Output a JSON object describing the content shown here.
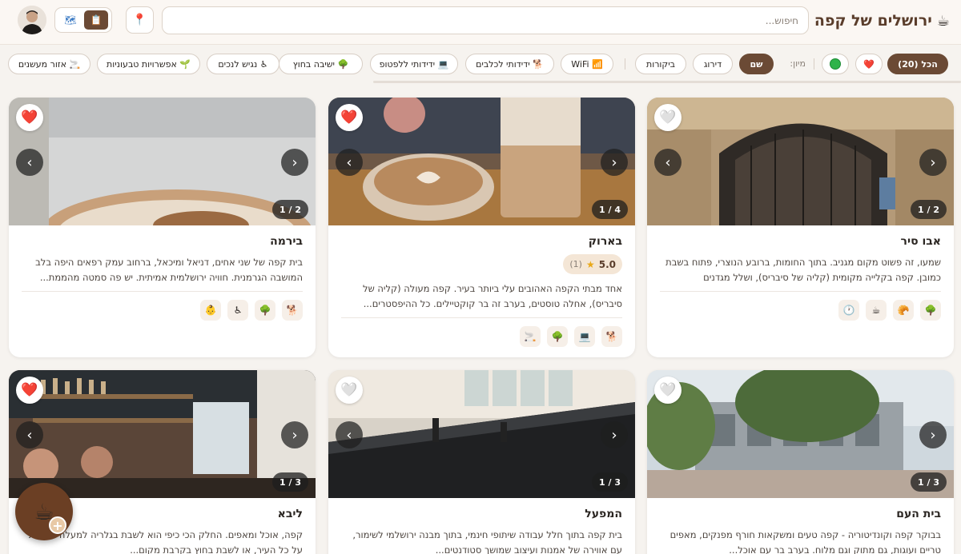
{
  "header": {
    "title": "ירושלים של קפה",
    "logo_icon": "coffee-cup",
    "search_placeholder": "חיפוש...",
    "locate_icon": "map-pin",
    "view_list_icon": "clipboard",
    "view_map_icon": "map"
  },
  "filters": {
    "all_label": "הכל (20)",
    "sort_label": "מיון:",
    "sort": {
      "name": "שם",
      "rating": "דירוג",
      "reviews": "ביקורות"
    },
    "chips": {
      "wifi": "📶 WiFi",
      "dogs": "🐕 ידידותי לכלבים",
      "laptop": "💻 ידידותי ללפטופ",
      "outdoor": "🌳 ישיבה בחוץ",
      "accessible": "♿ נגיש לנכים",
      "vegan": "🌱 אפשרויות טבעוניות",
      "smoking": "🚬 אזור מעשנים"
    }
  },
  "cards": [
    {
      "name": "אבו סיר",
      "description": "שמעו, זה פשוט מקום מגניב. בתוך החומות, ברובע הנוצרי, פתוח בשבת כמובן. קפה בקלייה מקומית (קליה של סיבריס), ושלל מגדנים ומאפים,...",
      "counter": "1 / 2",
      "favorite": false,
      "features": [
        "🌳",
        "🥐",
        "☕",
        "🕐"
      ]
    },
    {
      "name": "בארוק",
      "rating": "5.0",
      "rating_count": "(1)",
      "description": "אחד מבתי הקפה האהובים עלי ביותר בעיר. קפה מעולה (קליה של סיבריס), אחלה טוסטים, בערב זה בר קוקטיילים. כל ההיפסטרים...",
      "counter": "1 / 4",
      "favorite": true,
      "features": [
        "🐕",
        "💻",
        "🌳",
        "🚬"
      ]
    },
    {
      "name": "בירמה",
      "description": "בית קפה של שני אחים, דניאל ומיכאל, ברחוב עמק רפאים היפה בלב המושבה הגרמנית. חוויה ירושלמית אמיתית. יש פה סמטה מהממת...",
      "counter": "1 / 2",
      "favorite": true,
      "features": [
        "🐕",
        "🌳",
        "♿",
        "👶"
      ]
    },
    {
      "name": "בית העם",
      "description": "בבוקר קפה וקונדיטוריה - קפה טעים ומשקאות חורף מפנקים, מאפים טריים ועוגות, גם מתוק וגם מלוח. בערב בר עם אוכל...",
      "counter": "1 / 3",
      "favorite": false,
      "features": []
    },
    {
      "name": "המפעל",
      "description": "בית קפה בתוך חלל עבודה שיתופי חינמי, בתוך מבנה ירושלמי לשימור, עם אווירה של אמנות ועיצוב שמושך סטודנטים...",
      "counter": "1 / 3",
      "favorite": false,
      "features": []
    },
    {
      "name": "ליבא",
      "description": "קפה, אוכל ומאפים. החלק הכי כיפי הוא לשבת בגלריה למעלה ולצפות על כל העיר, או לשבת בחוץ בקרבת מקום...",
      "counter": "1 / 3",
      "favorite": true,
      "features": []
    }
  ],
  "colors": {
    "brand": "#6b4a35",
    "accent_red": "#e0323c",
    "background": "#f6f3ef"
  }
}
